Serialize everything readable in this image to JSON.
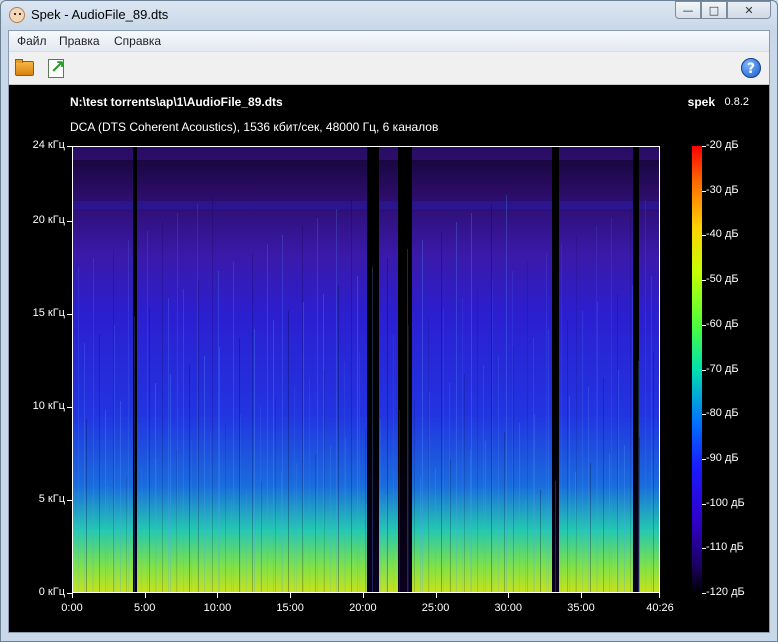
{
  "window": {
    "title": "Spek - AudioFile_89.dts",
    "minimize": "—",
    "maximize": "□",
    "close": "✕"
  },
  "menu": [
    "Файл",
    "Правка",
    "Справка"
  ],
  "toolbar": {
    "open_icon": "folder-open-icon",
    "save_icon": "save-image-icon",
    "help_label": "?"
  },
  "header": {
    "file_path": "N:\\test torrents\\ap\\1\\AudioFile_89.dts",
    "app_name": "spek",
    "app_version": "0.8.2",
    "file_info": "DCA (DTS Coherent Acoustics), 1536 кбит/сек, 48000 Гц, 6 каналов"
  },
  "chart_data": {
    "type": "heatmap",
    "y_axis": {
      "ticks": [
        "24 кГц",
        "20 кГц",
        "15 кГц",
        "10 кГц",
        "5 кГц",
        "0 кГц"
      ],
      "values_khz": [
        24,
        20,
        15,
        10,
        5,
        0
      ],
      "range_khz": [
        0,
        24
      ]
    },
    "x_axis": {
      "ticks": [
        "0:00",
        "5:00",
        "10:00",
        "15:00",
        "20:00",
        "25:00",
        "30:00",
        "35:00",
        "40:26"
      ],
      "values_min": [
        0,
        5,
        10,
        15,
        20,
        25,
        30,
        35,
        40.433
      ],
      "range_min": [
        0,
        40.433
      ]
    },
    "colorbar": {
      "ticks": [
        "-20 дБ",
        "-30 дБ",
        "-40 дБ",
        "-50 дБ",
        "-60 дБ",
        "-70 дБ",
        "-80 дБ",
        "-90 дБ",
        "-100 дБ",
        "-110 дБ",
        "-120 дБ"
      ],
      "values_db": [
        -20,
        -30,
        -40,
        -50,
        -60,
        -70,
        -80,
        -90,
        -100,
        -110,
        -120
      ],
      "range_db": [
        -120,
        -20
      ],
      "colors": [
        "#ff0000",
        "#ffd000",
        "#4dff3a",
        "#00e0b0",
        "#0070ff",
        "#3000c8",
        "#000000"
      ]
    },
    "silent_segments_min": [
      [
        4.2,
        4.5
      ],
      [
        20.3,
        21.1
      ],
      [
        22.4,
        23.4
      ],
      [
        33.0,
        33.5
      ],
      [
        38.6,
        39.0
      ]
    ]
  }
}
